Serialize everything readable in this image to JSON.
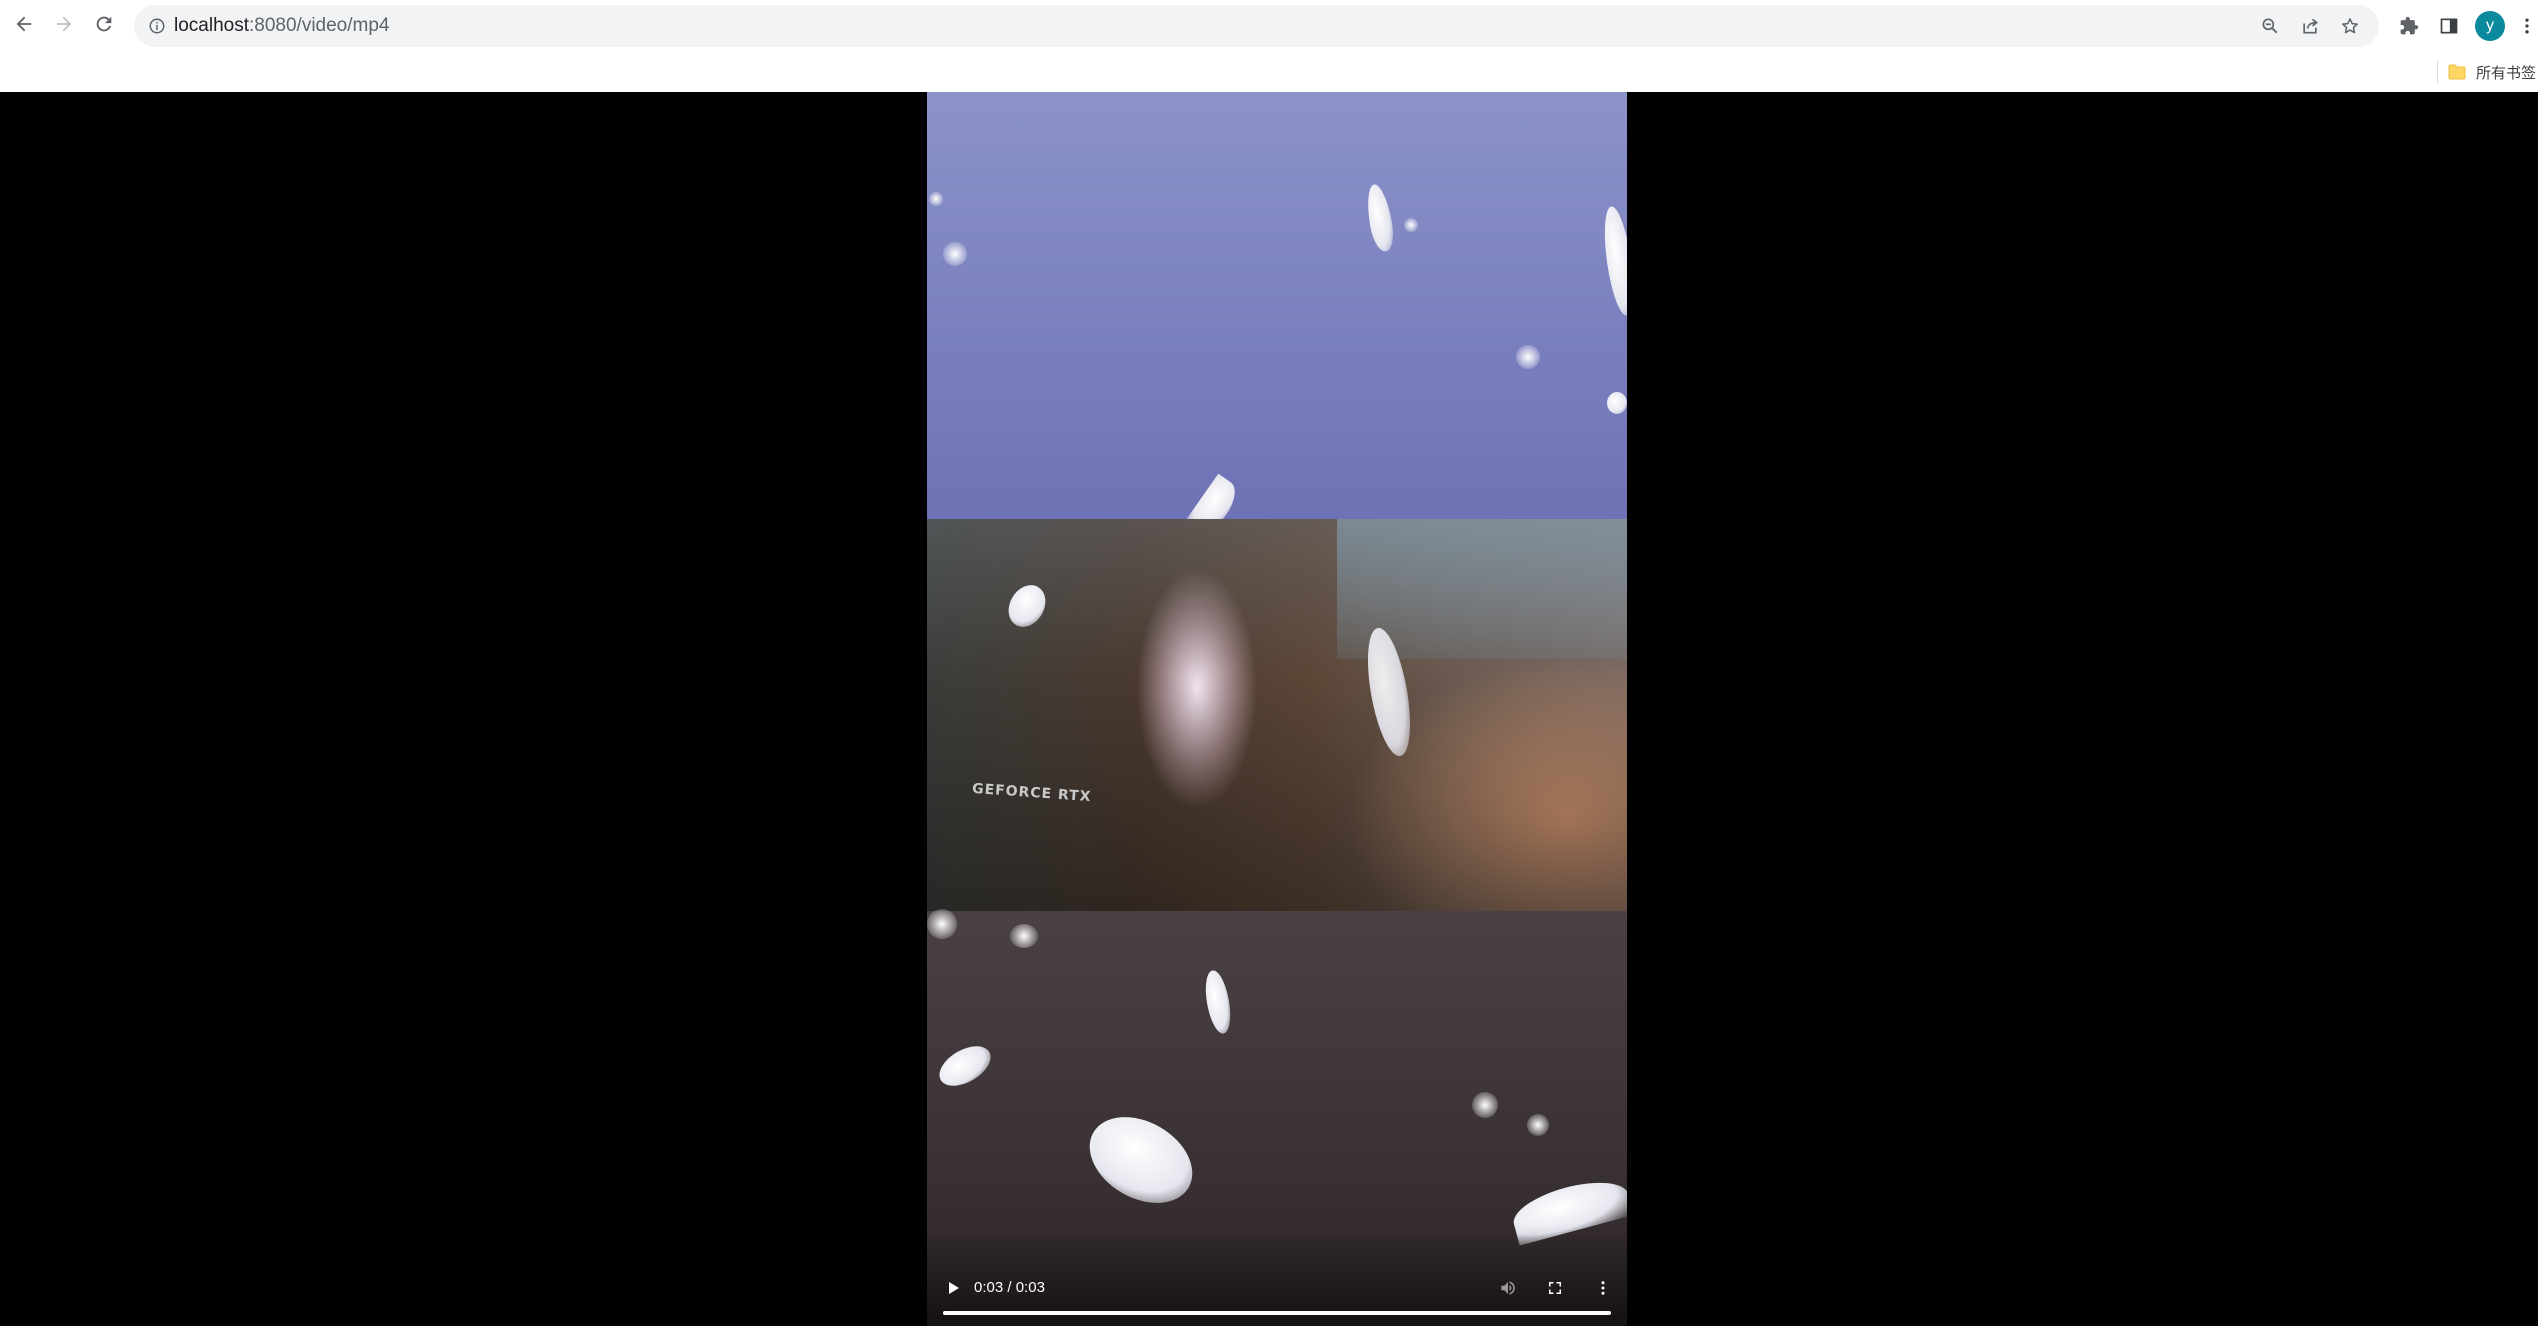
{
  "browser": {
    "url_host": "localhost",
    "url_path": ":8080/video/mp4",
    "profile_initial": "y",
    "bookmarks_folder_label": "所有书签",
    "accent_color": "#0b8a9e",
    "icons": {
      "back": "arrow-left",
      "forward": "arrow-right",
      "reload": "reload",
      "site_info": "info-circle",
      "zoom": "magnifier-minus",
      "share": "share",
      "bookmark": "star-outline",
      "extensions": "puzzle",
      "side_panel": "side-panel",
      "menu": "vertical-dots",
      "folder": "folder"
    }
  },
  "video": {
    "frame_text": "GEFORCE RTX",
    "current_time": "0:03",
    "duration": "0:03",
    "progress_fraction": 1.0,
    "controls": {
      "play": "play-icon",
      "volume": "volume-icon",
      "fullscreen": "fullscreen-icon",
      "more": "more-vert-icon"
    }
  }
}
